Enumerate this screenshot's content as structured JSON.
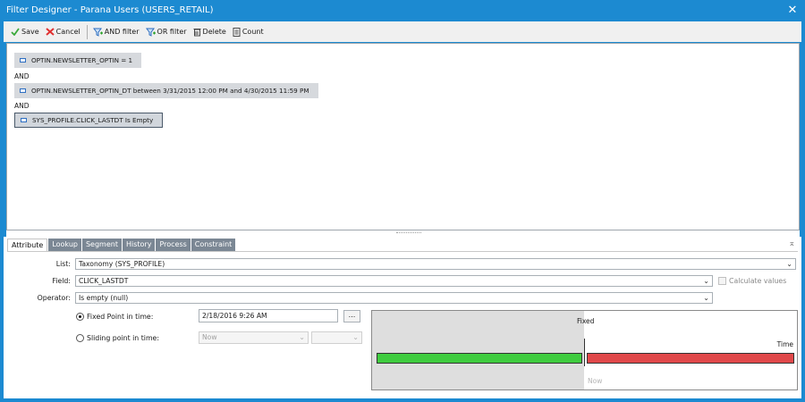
{
  "window": {
    "title": "Filter Designer - Parana Users (USERS_RETAIL)",
    "close_label": "✕"
  },
  "toolbar": {
    "save_label": "Save",
    "cancel_label": "Cancel",
    "and_filter_label": "AND filter",
    "or_filter_label": "OR filter",
    "delete_label": "Delete",
    "count_label": "Count"
  },
  "filter": {
    "conditions": [
      "OPTIN.NEWSLETTER_OPTIN = 1",
      "OPTIN.NEWSLETTER_OPTIN_DT between 3/31/2015 12:00 PM and 4/30/2015 11:59 PM",
      "SYS_PROFILE.CLICK_LASTDT Is Empty"
    ],
    "operators": [
      "AND",
      "AND"
    ]
  },
  "tabs": [
    "Attribute",
    "Lookup",
    "Segment",
    "History",
    "Process",
    "Constraint"
  ],
  "attribute": {
    "list_label": "List:",
    "list_value": "Taxonomy (SYS_PROFILE)",
    "field_label": "Field:",
    "field_value": "CLICK_LASTDT",
    "calculate_label": "Calculate values",
    "operator_label": "Operator:",
    "operator_value": "Is empty (null)",
    "fixed_point_label": "Fixed Point in time:",
    "fixed_point_value": "2/18/2016 9:26 AM",
    "ellipsis_label": "...",
    "sliding_point_label": "Sliding point in time:",
    "sliding_value": "Now"
  },
  "timeline": {
    "fixed_label": "Fixed",
    "time_label": "Time",
    "now_label": "Now"
  },
  "colors": {
    "accent": "#1c8ad1",
    "bar_green": "#3fcc3f",
    "bar_red": "#e0484a"
  }
}
